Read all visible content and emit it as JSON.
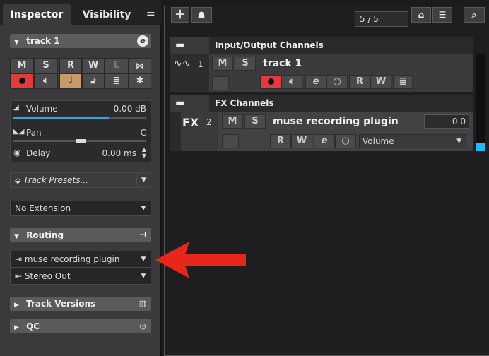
{
  "inspector": {
    "tabs": {
      "inspector": "Inspector",
      "visibility": "Visibility",
      "menu": "="
    },
    "track_name": "track 1",
    "track_edit_icon": "e",
    "buttons": {
      "m": "M",
      "s": "S",
      "r": "R",
      "w": "W",
      "l": "L"
    },
    "params": {
      "volume_label": "Volume",
      "volume_value": "0.00 dB",
      "volume_fraction": 0.72,
      "pan_label": "Pan",
      "pan_value": "C",
      "delay_label": "Delay",
      "delay_value": "0.00 ms"
    },
    "track_presets": "Track Presets...",
    "no_extension": "No Extension",
    "routing": {
      "title": "Routing",
      "input": "muse recording plugin",
      "output": "Stereo Out"
    },
    "track_versions": "Track Versions",
    "qc": "QC"
  },
  "project": {
    "counter": "5 / 5",
    "folders": {
      "io": "Input/Output Channels",
      "fx": "FX Channels"
    },
    "track1": {
      "number": "1",
      "name": "track 1"
    },
    "track2": {
      "number": "2",
      "name": "muse recording plugin",
      "label": "FX",
      "value": "0.0",
      "automation": "Volume"
    },
    "buttons": {
      "m": "M",
      "s": "S",
      "r": "R",
      "w": "W"
    }
  },
  "colors": {
    "accent_blue": "#3aa0e0",
    "record_red": "#e33b3b",
    "arrow_red": "#e8271b"
  }
}
